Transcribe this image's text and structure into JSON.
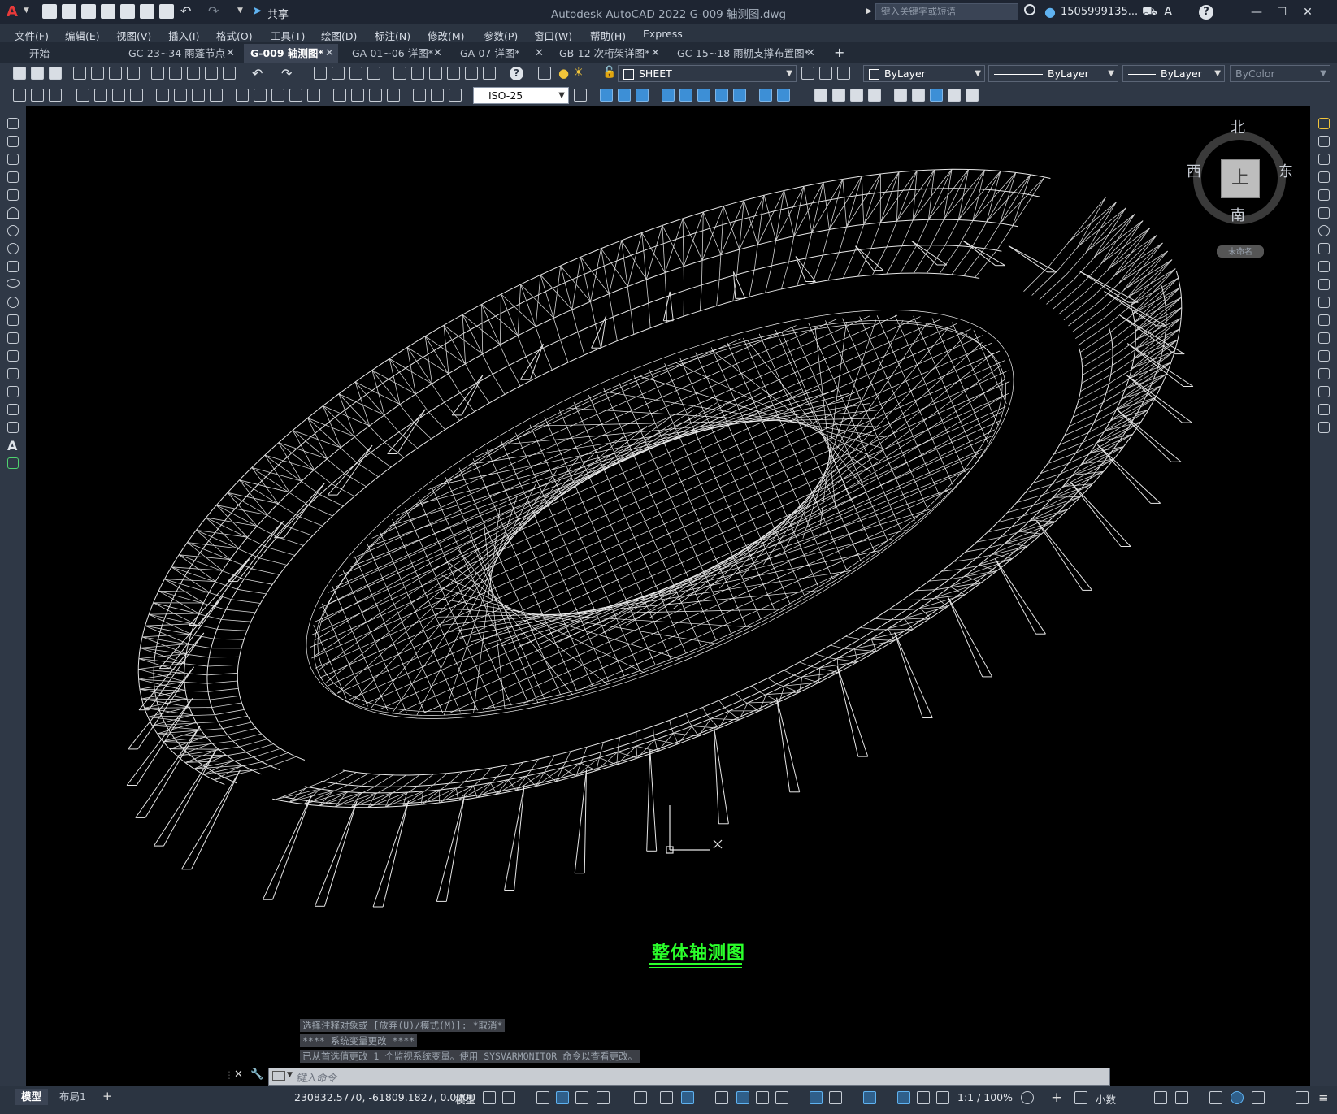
{
  "window": {
    "title": "Autodesk AutoCAD 2022    G-009 轴测图.dwg",
    "search_placeholder": "键入关键字或短语",
    "user": "1505999135...",
    "share_label": "共享"
  },
  "menu": [
    "文件(F)",
    "编辑(E)",
    "视图(V)",
    "插入(I)",
    "格式(O)",
    "工具(T)",
    "绘图(D)",
    "标注(N)",
    "修改(M)",
    "参数(P)",
    "窗口(W)",
    "帮助(H)",
    "Express"
  ],
  "tabs": [
    {
      "label": "开始",
      "closable": false,
      "active": false
    },
    {
      "label": "GC-23~34 雨蓬节点",
      "closable": true,
      "active": false
    },
    {
      "label": "G-009 轴测图*",
      "closable": true,
      "active": true
    },
    {
      "label": "GA-01~06 详图*",
      "closable": true,
      "active": false
    },
    {
      "label": "GA-07 详图*",
      "closable": true,
      "active": false
    },
    {
      "label": "GB-12 次桁架详图*",
      "closable": true,
      "active": false
    },
    {
      "label": "GC-15~18 雨棚支撑布置图*",
      "closable": true,
      "active": false
    }
  ],
  "toolbar": {
    "layer": "SHEET",
    "color": "ByLayer",
    "linetype": "ByLayer",
    "lineweight": "ByLayer",
    "plotstyle": "ByColor",
    "dimstyle": "ISO-25"
  },
  "viewcube": {
    "north": "北",
    "south": "南",
    "east": "东",
    "west": "西",
    "top_face": "上",
    "ucs_label": "未命名"
  },
  "drawing": {
    "title": "整体轴测图"
  },
  "command": {
    "history": [
      "选择注释对象或 [放弃(U)/模式(M)]: *取消*",
      "**** 系统变量更改 ****",
      "已从首选值更改 1 个监视系统变量。使用 SYSVARMONITOR 命令以查看更改。"
    ],
    "placeholder": "键入命令"
  },
  "status": {
    "model_tab": "模型",
    "layout_tab": "布局1",
    "coords": "230832.5770, -61809.1827, 0.0000",
    "space": "模型",
    "scale": "1:1 / 100%",
    "units": "小数"
  }
}
